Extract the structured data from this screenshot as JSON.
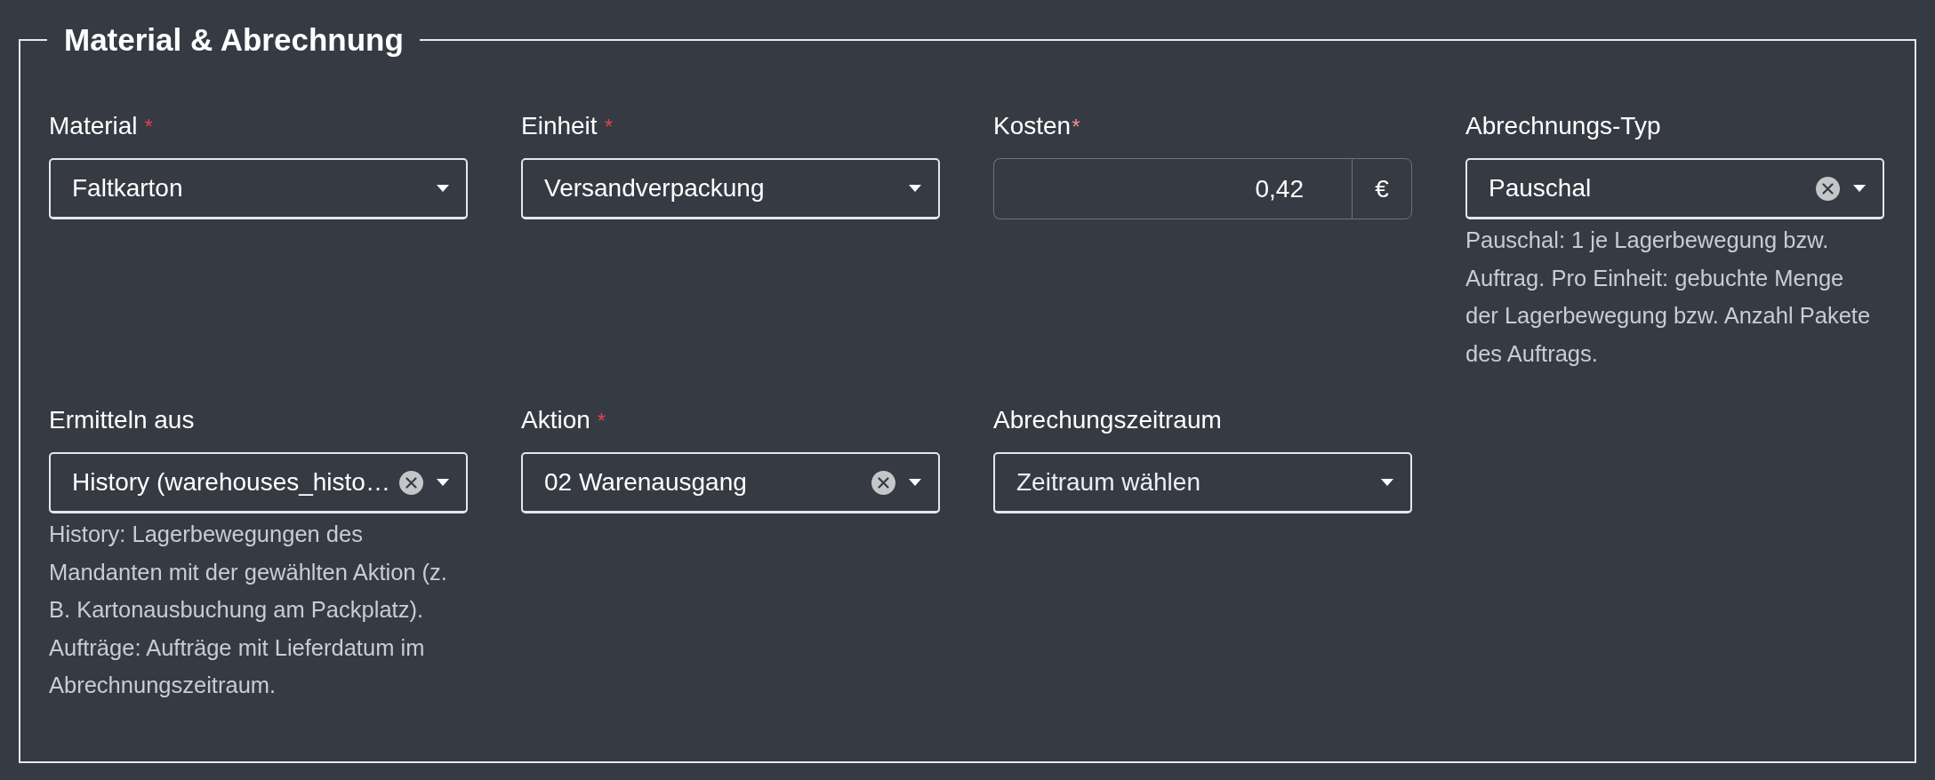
{
  "section": {
    "title": "Material & Abrechnung"
  },
  "fields": [
    {
      "kind": "select",
      "label": "Material",
      "required_mark": "*",
      "value": "Faltkarton",
      "clearable": false
    },
    {
      "kind": "select",
      "label": "Einheit",
      "required_mark": "*",
      "value": "Versandverpackung",
      "clearable": false
    },
    {
      "kind": "currency",
      "label": "Kosten",
      "required_mark": "*",
      "value": "0,42",
      "addon": "€"
    },
    {
      "kind": "select",
      "label": "Abrechnungs-Typ",
      "value": "Pauschal",
      "clearable": true,
      "help": "Pauschal: 1 je Lagerbewegung bzw. Auftrag. Pro Einheit: gebuchte Menge der Lagerbewegung bzw. Anzahl Pakete des Auftrags."
    },
    {
      "kind": "select",
      "label": "Ermitteln aus",
      "value": "History (warehouses_histo…",
      "clearable": true,
      "help": "History: Lagerbewegungen des Mandanten mit der gewählten Aktion (z. B. Kartonausbuchung am Packplatz). Aufträge: Aufträge mit Lieferdatum im Abrechnungszeitraum."
    },
    {
      "kind": "select",
      "label": "Aktion",
      "required_mark": "*",
      "value": "02 Warenausgang",
      "clearable": true
    },
    {
      "kind": "select",
      "label": "Abrechungszeitraum",
      "placeholder": "Zeitraum wählen",
      "clearable": false
    }
  ]
}
